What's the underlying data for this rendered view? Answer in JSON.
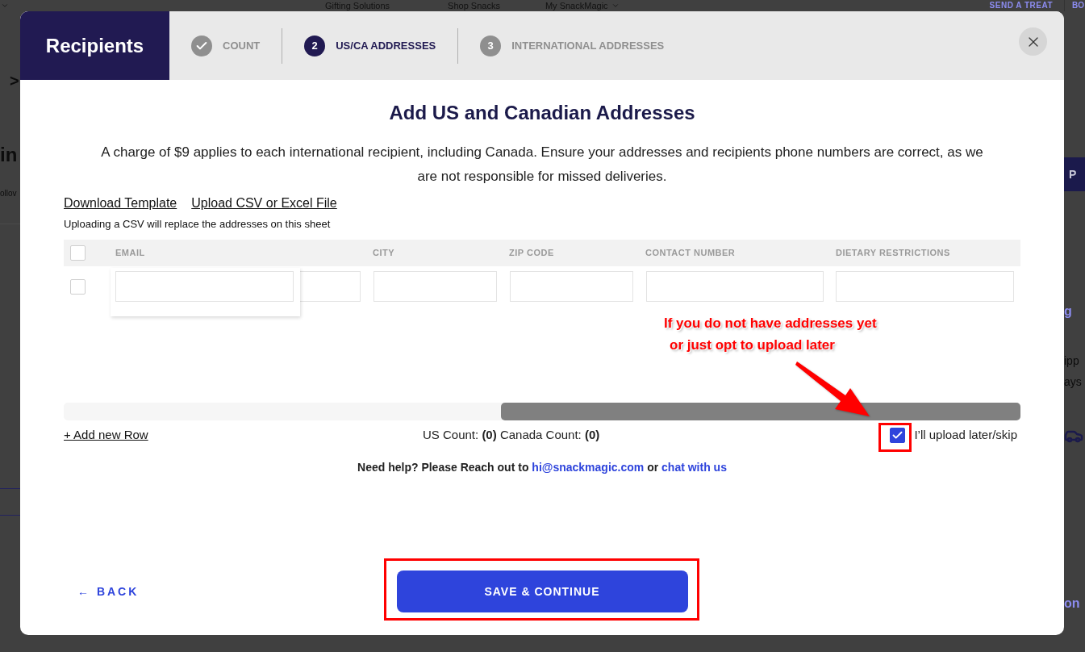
{
  "backdrop": {
    "nav_links": [
      {
        "label": "Gifting Solutions",
        "has_menu": false
      },
      {
        "label": "Shop Snacks",
        "has_menu": false
      },
      {
        "label": "My SnackMagic",
        "has_menu": true
      }
    ],
    "cta": "SEND A TREAT",
    "cut_link": "BO",
    "left_fragments": [
      {
        "text": ">",
        "kind": "crumb"
      },
      {
        "text": "in",
        "kind": "heading"
      },
      {
        "text": "ollov",
        "kind": "body"
      }
    ],
    "right_fragments": [
      {
        "text": "P",
        "kind": "button"
      },
      {
        "text": "g",
        "kind": "link"
      },
      {
        "text": "ipp",
        "kind": "body"
      },
      {
        "text": "ays",
        "kind": "body"
      },
      {
        "text": "on",
        "kind": "link"
      }
    ]
  },
  "modal": {
    "title": "Recipients",
    "steps": [
      {
        "label": "COUNT",
        "completed": true,
        "selected": false
      },
      {
        "number": "2",
        "label": "US/CA ADDRESSES",
        "completed": false,
        "selected": true
      },
      {
        "number": "3",
        "label": "INTERNATIONAL ADDRESSES",
        "completed": false,
        "selected": false
      }
    ],
    "heading": "Add US and Canadian Addresses",
    "description": "A charge of $9 applies to each international recipient, including Canada. Ensure your addresses and recipients phone numbers are correct, as we are not responsible for missed deliveries.",
    "links": [
      "Download Template",
      "Upload CSV or Excel File"
    ],
    "note": "Uploading a CSV will replace the addresses on this sheet",
    "table": {
      "select_all_checked": false,
      "columns": [
        {
          "label": "EMAIL"
        },
        {
          "label": "CITY"
        },
        {
          "label": "ZIP CODE"
        },
        {
          "label": "CONTACT NUMBER"
        },
        {
          "label": "DIETARY RESTRICTIONS"
        }
      ],
      "rows": [
        {
          "checked": false,
          "editing": true
        }
      ]
    },
    "add_row": "+ Add new Row",
    "counts": "US Count: **(0)** Canada Count: **(0)**",
    "skip": {
      "label": "I’ll upload later/skip",
      "checked": true,
      "highlighted": true
    },
    "help": {
      "text": "Need help? Please Reach out to",
      "email": "hi@snackmagic.com",
      "joiner": "or",
      "chat": "chat with us"
    },
    "back": "← BACK",
    "save": {
      "label": "SAVE & CONTINUE",
      "highlighted": true
    }
  },
  "annotation": {
    "lines": [
      "If you do not have addresses yet",
      "or just opt to upload later"
    ]
  }
}
